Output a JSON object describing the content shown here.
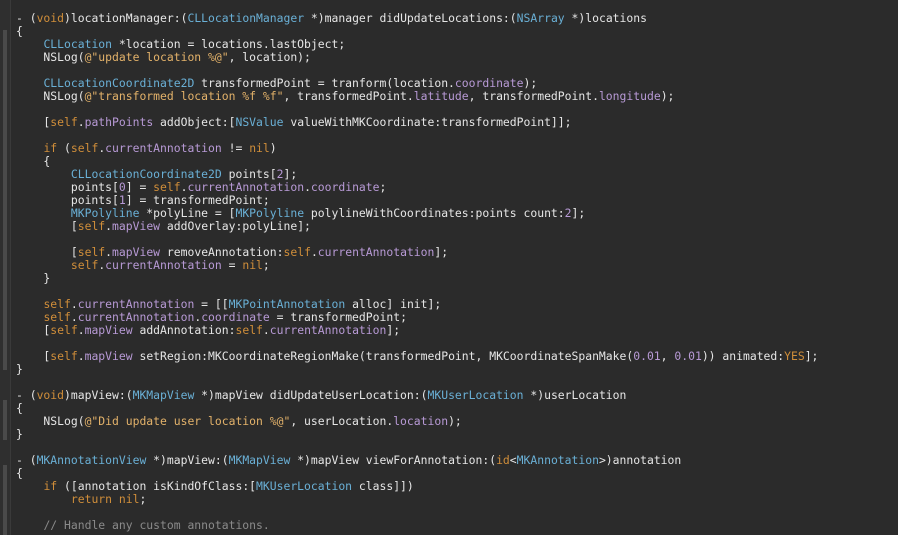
{
  "editor": {
    "lines": [
      [
        [
          "- (",
          ""
        ],
        [
          "void",
          "kw"
        ],
        [
          ")locationManager:(",
          ""
        ],
        [
          "CLLocationManager",
          "type"
        ],
        [
          " *)manager didUpdateLocations:(",
          ""
        ],
        [
          "NSArray",
          "type"
        ],
        [
          " *)locations",
          ""
        ]
      ],
      [
        [
          "{",
          ""
        ]
      ],
      [
        [
          "    ",
          ""
        ],
        [
          "CLLocation",
          "type"
        ],
        [
          " *location = locations.lastObject;",
          ""
        ]
      ],
      [
        [
          "    NSLog(",
          ""
        ],
        [
          "@\"update location %@\"",
          "str"
        ],
        [
          ", location);",
          ""
        ]
      ],
      [
        [
          "",
          ""
        ]
      ],
      [
        [
          "    ",
          ""
        ],
        [
          "CLLocationCoordinate2D",
          "type"
        ],
        [
          " transformedPoint = tranform(location.",
          ""
        ],
        [
          "coordinate",
          "prop"
        ],
        [
          ");",
          ""
        ]
      ],
      [
        [
          "    NSLog(",
          ""
        ],
        [
          "@\"transformed location %f %f\"",
          "str"
        ],
        [
          ", transformedPoint.",
          ""
        ],
        [
          "latitude",
          "prop"
        ],
        [
          ", transformedPoint.",
          ""
        ],
        [
          "longitude",
          "prop"
        ],
        [
          ");",
          ""
        ]
      ],
      [
        [
          "",
          ""
        ]
      ],
      [
        [
          "    [",
          ""
        ],
        [
          "self",
          "kw"
        ],
        [
          ".",
          ""
        ],
        [
          "pathPoints",
          "prop"
        ],
        [
          " addObject:[",
          ""
        ],
        [
          "NSValue",
          "type"
        ],
        [
          " valueWithMKCoordinate:transformedPoint]];",
          ""
        ]
      ],
      [
        [
          "",
          ""
        ]
      ],
      [
        [
          "    ",
          ""
        ],
        [
          "if",
          "kw"
        ],
        [
          " (",
          ""
        ],
        [
          "self",
          "kw"
        ],
        [
          ".",
          ""
        ],
        [
          "currentAnnotation",
          "prop"
        ],
        [
          " != ",
          ""
        ],
        [
          "nil",
          "kw"
        ],
        [
          ")",
          ""
        ]
      ],
      [
        [
          "    {",
          ""
        ]
      ],
      [
        [
          "        ",
          ""
        ],
        [
          "CLLocationCoordinate2D",
          "type"
        ],
        [
          " points[",
          ""
        ],
        [
          "2",
          "prop"
        ],
        [
          "];",
          ""
        ]
      ],
      [
        [
          "        points[",
          ""
        ],
        [
          "0",
          "prop"
        ],
        [
          "] = ",
          ""
        ],
        [
          "self",
          "kw"
        ],
        [
          ".",
          ""
        ],
        [
          "currentAnnotation",
          "prop"
        ],
        [
          ".",
          ""
        ],
        [
          "coordinate",
          "prop"
        ],
        [
          ";",
          ""
        ]
      ],
      [
        [
          "        points[",
          ""
        ],
        [
          "1",
          "prop"
        ],
        [
          "] = transformedPoint;",
          ""
        ]
      ],
      [
        [
          "        ",
          ""
        ],
        [
          "MKPolyline",
          "type"
        ],
        [
          " *polyLine = [",
          ""
        ],
        [
          "MKPolyline",
          "type"
        ],
        [
          " polylineWithCoordinates:points count:",
          ""
        ],
        [
          "2",
          "prop"
        ],
        [
          "];",
          ""
        ]
      ],
      [
        [
          "        [",
          ""
        ],
        [
          "self",
          "kw"
        ],
        [
          ".",
          ""
        ],
        [
          "mapView",
          "prop"
        ],
        [
          " addOverlay:polyLine];",
          ""
        ]
      ],
      [
        [
          "",
          ""
        ]
      ],
      [
        [
          "        [",
          ""
        ],
        [
          "self",
          "kw"
        ],
        [
          ".",
          ""
        ],
        [
          "mapView",
          "prop"
        ],
        [
          " removeAnnotation:",
          ""
        ],
        [
          "self",
          "kw"
        ],
        [
          ".",
          ""
        ],
        [
          "currentAnnotation",
          "prop"
        ],
        [
          "];",
          ""
        ]
      ],
      [
        [
          "        ",
          ""
        ],
        [
          "self",
          "kw"
        ],
        [
          ".",
          ""
        ],
        [
          "currentAnnotation",
          "prop"
        ],
        [
          " = ",
          ""
        ],
        [
          "nil",
          "kw"
        ],
        [
          ";",
          ""
        ]
      ],
      [
        [
          "    }",
          ""
        ]
      ],
      [
        [
          "",
          ""
        ]
      ],
      [
        [
          "    ",
          ""
        ],
        [
          "self",
          "kw"
        ],
        [
          ".",
          ""
        ],
        [
          "currentAnnotation",
          "prop"
        ],
        [
          " = [[",
          ""
        ],
        [
          "MKPointAnnotation",
          "type"
        ],
        [
          " alloc] init];",
          ""
        ]
      ],
      [
        [
          "    ",
          ""
        ],
        [
          "self",
          "kw"
        ],
        [
          ".",
          ""
        ],
        [
          "currentAnnotation",
          "prop"
        ],
        [
          ".",
          ""
        ],
        [
          "coordinate",
          "prop"
        ],
        [
          " = transformedPoint;",
          ""
        ]
      ],
      [
        [
          "    [",
          ""
        ],
        [
          "self",
          "kw"
        ],
        [
          ".",
          ""
        ],
        [
          "mapView",
          "prop"
        ],
        [
          " addAnnotation:",
          ""
        ],
        [
          "self",
          "kw"
        ],
        [
          ".",
          ""
        ],
        [
          "currentAnnotation",
          "prop"
        ],
        [
          "];",
          ""
        ]
      ],
      [
        [
          "",
          ""
        ]
      ],
      [
        [
          "    [",
          ""
        ],
        [
          "self",
          "kw"
        ],
        [
          ".",
          ""
        ],
        [
          "mapView",
          "prop"
        ],
        [
          " setRegion:MKCoordinateRegionMake(transformedPoint, MKCoordinateSpanMake(",
          ""
        ],
        [
          "0.01",
          "prop"
        ],
        [
          ", ",
          ""
        ],
        [
          "0.01",
          "prop"
        ],
        [
          ")) animated:",
          ""
        ],
        [
          "YES",
          "kw"
        ],
        [
          "];",
          ""
        ]
      ],
      [
        [
          "}",
          ""
        ]
      ],
      [
        [
          "",
          ""
        ]
      ],
      [
        [
          "- (",
          ""
        ],
        [
          "void",
          "kw"
        ],
        [
          ")mapView:(",
          ""
        ],
        [
          "MKMapView",
          "type"
        ],
        [
          " *)mapView didUpdateUserLocation:(",
          ""
        ],
        [
          "MKUserLocation",
          "type"
        ],
        [
          " *)userLocation",
          ""
        ]
      ],
      [
        [
          "{",
          ""
        ]
      ],
      [
        [
          "    NSLog(",
          ""
        ],
        [
          "@\"Did update user location %@\"",
          "str"
        ],
        [
          ", userLocation.",
          ""
        ],
        [
          "location",
          "prop"
        ],
        [
          ");",
          ""
        ]
      ],
      [
        [
          "}",
          ""
        ]
      ],
      [
        [
          "",
          ""
        ]
      ],
      [
        [
          "- (",
          ""
        ],
        [
          "MKAnnotationView",
          "type"
        ],
        [
          " *)mapView:(",
          ""
        ],
        [
          "MKMapView",
          "type"
        ],
        [
          " *)mapView viewForAnnotation:(",
          ""
        ],
        [
          "id",
          "kw"
        ],
        [
          "<",
          ""
        ],
        [
          "MKAnnotation",
          "type"
        ],
        [
          ">)annotation",
          ""
        ]
      ],
      [
        [
          "{",
          ""
        ]
      ],
      [
        [
          "    ",
          ""
        ],
        [
          "if",
          "kw"
        ],
        [
          " ([annotation isKindOfClass:[",
          ""
        ],
        [
          "MKUserLocation",
          "type"
        ],
        [
          " class]])",
          ""
        ]
      ],
      [
        [
          "        ",
          ""
        ],
        [
          "return",
          "kw"
        ],
        [
          " ",
          ""
        ],
        [
          "nil",
          "kw"
        ],
        [
          ";",
          ""
        ]
      ],
      [
        [
          "",
          ""
        ]
      ],
      [
        [
          "    ",
          ""
        ],
        [
          "// Handle any custom annotations.",
          "cmt"
        ]
      ]
    ]
  }
}
